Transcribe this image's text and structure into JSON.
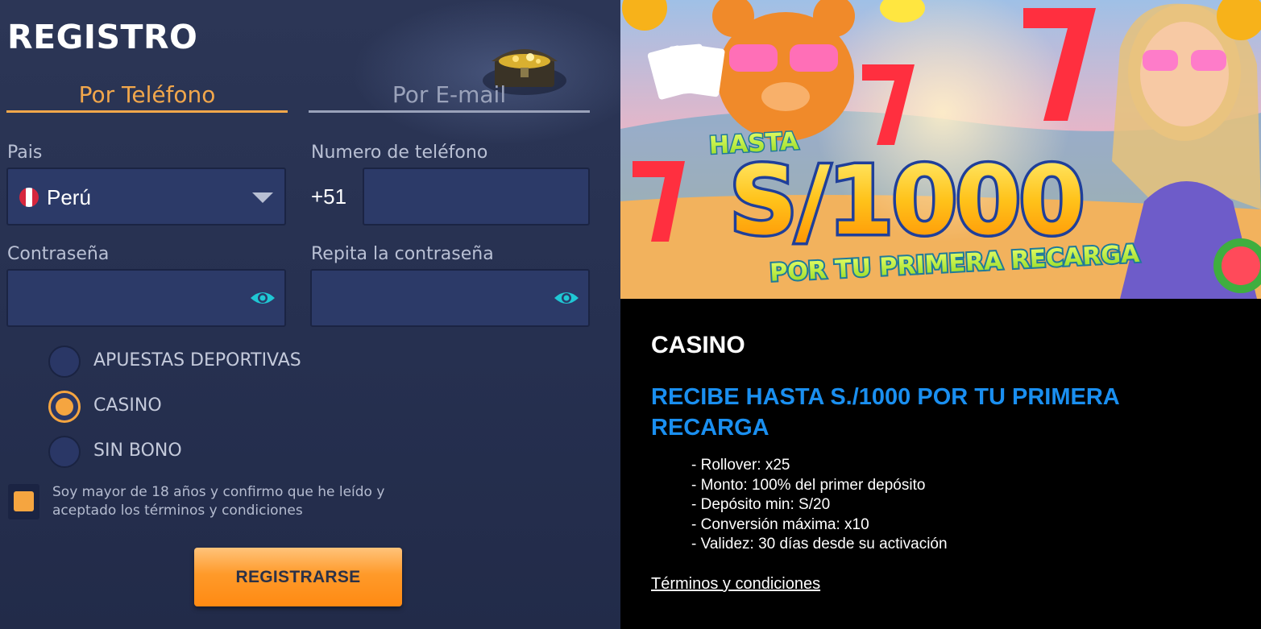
{
  "registration": {
    "title": "REGISTRO",
    "tabs": [
      {
        "label": "Por Teléfono",
        "active": true
      },
      {
        "label": "Por E-mail",
        "active": false
      }
    ],
    "country": {
      "label": "Pais",
      "value": "Perú",
      "flag_icon": "peru-flag-icon"
    },
    "phone": {
      "label": "Numero de teléfono",
      "prefix": "+51",
      "value": ""
    },
    "password": {
      "label": "Contraseña",
      "value": ""
    },
    "repeat_password": {
      "label": "Repita la contraseña",
      "value": ""
    },
    "bonus_options": [
      {
        "label": "APUESTAS DEPORTIVAS",
        "selected": false
      },
      {
        "label": "CASINO",
        "selected": true
      },
      {
        "label": "SIN BONO",
        "selected": false
      }
    ],
    "terms": {
      "text": "Soy mayor de 18 años y confirmo que he leído y aceptado los términos y condiciones",
      "checked": true
    },
    "submit_label": "REGISTRARSE"
  },
  "banner": {
    "line1": "HASTA",
    "amount": "S/1000",
    "line2": "POR TU PRIMERA RECARGA"
  },
  "promo": {
    "category": "CASINO",
    "headline": "RECIBE HASTA S./1000 POR TU PRIMERA RECARGA",
    "details": [
      "- Rollover: x25",
      "- Monto: 100% del primer depósito",
      "- Depósito min: S/20",
      "- Conversión máxima: x10",
      "- Validez: 30 días desde su activación"
    ],
    "terms_link": "Términos y condiciones"
  },
  "colors": {
    "accent": "#f5a540",
    "panel_bg": "#263050",
    "headline_blue": "#1a8ff0",
    "eye_icon": "#1fc7d4"
  }
}
